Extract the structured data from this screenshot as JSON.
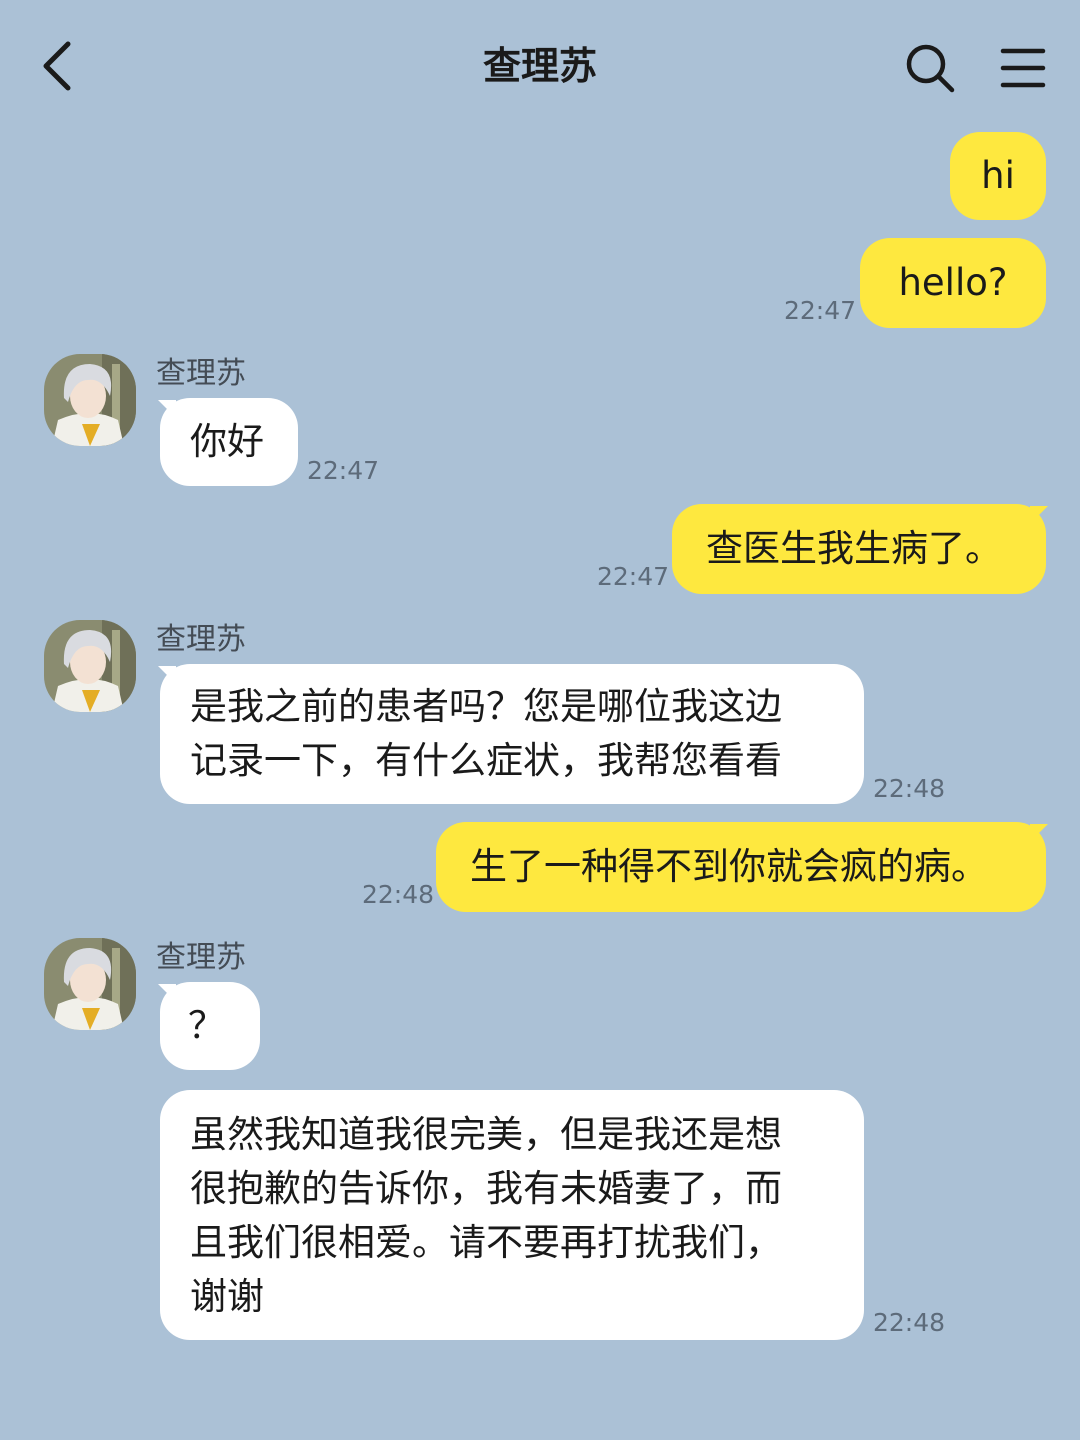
{
  "header": {
    "title": "查理苏",
    "back_icon": "chevron-left-icon",
    "search_icon": "search-icon",
    "menu_icon": "hamburger-menu-icon"
  },
  "colors": {
    "background": "#abc1d6",
    "my_bubble": "#fee83f",
    "their_bubble": "#ffffff"
  },
  "messages": [
    {
      "from": "me",
      "text": "hi",
      "time": ""
    },
    {
      "from": "me",
      "text": "hello?",
      "time": "22:47"
    },
    {
      "from": "other",
      "sender": "查理苏",
      "text": "你好",
      "time": "22:47"
    },
    {
      "from": "me",
      "text": "查医生我生病了。",
      "time": "22:47"
    },
    {
      "from": "other",
      "sender": "查理苏",
      "text": "是我之前的患者吗？您是哪位我这边\n记录一下，有什么症状，我帮您看看",
      "time": "22:48"
    },
    {
      "from": "me",
      "text": "生了一种得不到你就会疯的病。",
      "time": "22:48"
    },
    {
      "from": "other",
      "sender": "查理苏",
      "text": "？",
      "time": ""
    },
    {
      "from": "other",
      "sender": "",
      "text": "虽然我知道我很完美，但是我还是想\n很抱歉的告诉你，我有未婚妻了，而\n且我们很相爱。请不要再打扰我们，\n谢谢",
      "time": "22:48"
    }
  ]
}
